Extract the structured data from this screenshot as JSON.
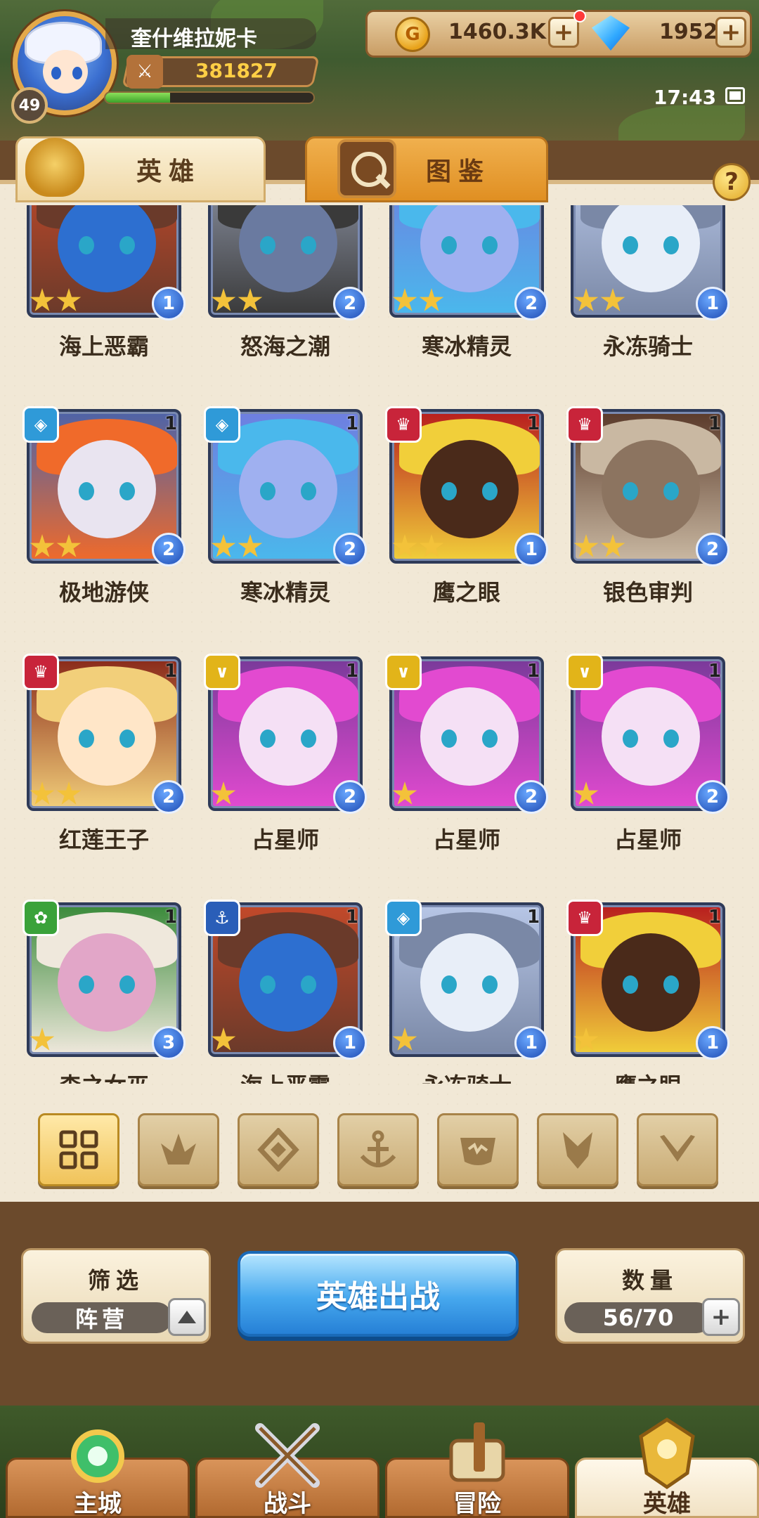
{
  "player": {
    "name": "奎什维拉妮卡",
    "level": "49",
    "power": "381827",
    "exp_fraction": 0.31
  },
  "currency": {
    "gold": "1460.3K",
    "gems": "1952"
  },
  "status": {
    "time": "17:43"
  },
  "tabs": {
    "heroes": "英雄",
    "codex": "图鉴"
  },
  "heroes": [
    {
      "name": "海上恶霸",
      "stars": 2,
      "rank": "1",
      "level": "",
      "faction": "",
      "colors": [
        "#c2492a",
        "#6a3a2a",
        "#2d6fd0"
      ]
    },
    {
      "name": "怒海之潮",
      "stars": 2,
      "rank": "2",
      "level": "",
      "faction": "",
      "colors": [
        "#8f96a8",
        "#3a3a3a",
        "#6a7aa0"
      ]
    },
    {
      "name": "寒冰精灵",
      "stars": 2,
      "rank": "2",
      "level": "",
      "faction": "",
      "colors": [
        "#6f7ee0",
        "#4ab8ec",
        "#9fb0f0"
      ]
    },
    {
      "name": "永冻骑士",
      "stars": 2,
      "rank": "1",
      "level": "",
      "faction": "",
      "colors": [
        "#b7c6e6",
        "#7a88a6",
        "#e8eef8"
      ]
    },
    {
      "name": "极地游侠",
      "stars": 2,
      "rank": "2",
      "level": "1",
      "faction": "ice",
      "colors": [
        "#4d63a8",
        "#f06a2a",
        "#e9e4f0"
      ]
    },
    {
      "name": "寒冰精灵",
      "stars": 2,
      "rank": "2",
      "level": "1",
      "faction": "ice",
      "colors": [
        "#6f7ee0",
        "#4ab8ec",
        "#9fb0f0"
      ]
    },
    {
      "name": "鹰之眼",
      "stars": 2,
      "rank": "1",
      "level": "1",
      "faction": "fire",
      "colors": [
        "#b81e1e",
        "#f1cf3a",
        "#4a2a1a"
      ]
    },
    {
      "name": "银色审判",
      "stars": 2,
      "rank": "2",
      "level": "1",
      "faction": "fire",
      "colors": [
        "#5a3a2a",
        "#c9b8a2",
        "#8c7460"
      ]
    },
    {
      "name": "红莲王子",
      "stars": 2,
      "rank": "2",
      "level": "1",
      "faction": "fire",
      "colors": [
        "#8a2a1a",
        "#f2cf7a",
        "#ffe6c8"
      ]
    },
    {
      "name": "占星师",
      "stars": 1,
      "rank": "2",
      "level": "1",
      "faction": "light",
      "colors": [
        "#7a3a9a",
        "#e24ad0",
        "#f5e0f5"
      ]
    },
    {
      "name": "占星师",
      "stars": 1,
      "rank": "2",
      "level": "1",
      "faction": "light",
      "colors": [
        "#7a3a9a",
        "#e24ad0",
        "#f5e0f5"
      ]
    },
    {
      "name": "占星师",
      "stars": 1,
      "rank": "2",
      "level": "1",
      "faction": "light",
      "colors": [
        "#7a3a9a",
        "#e24ad0",
        "#f5e0f5"
      ]
    },
    {
      "name": "森之女巫",
      "stars": 1,
      "rank": "3",
      "level": "1",
      "faction": "forest",
      "colors": [
        "#3a8a3a",
        "#efe8dc",
        "#e2a6c8"
      ]
    },
    {
      "name": "海上恶霸",
      "stars": 1,
      "rank": "1",
      "level": "1",
      "faction": "sea",
      "colors": [
        "#c2492a",
        "#6a3a2a",
        "#2d6fd0"
      ]
    },
    {
      "name": "永冻骑士",
      "stars": 1,
      "rank": "1",
      "level": "1",
      "faction": "ice",
      "colors": [
        "#b7c6e6",
        "#7a88a6",
        "#e8eef8"
      ]
    },
    {
      "name": "鹰之眼",
      "stars": 1,
      "rank": "1",
      "level": "1",
      "faction": "fire",
      "colors": [
        "#b81e1e",
        "#f1cf3a",
        "#4a2a1a"
      ]
    }
  ],
  "faction_colors": {
    "ice": "#2f9ad8",
    "fire": "#c8243a",
    "light": "#e2b419",
    "forest": "#3aa23a",
    "sea": "#2a5eb8"
  },
  "faction_filters": [
    "all-icon",
    "fire-faction-icon",
    "ice-faction-icon",
    "sea-faction-icon",
    "beast-faction-icon",
    "dark-faction-icon",
    "light-faction-icon"
  ],
  "controls": {
    "filter_title": "筛选",
    "filter_value": "阵营",
    "deploy_label": "英雄出战",
    "count_title": "数量",
    "count_value": "56/70"
  },
  "bottom_nav": [
    {
      "label": "主城",
      "icon": "castle-icon",
      "active": false
    },
    {
      "label": "战斗",
      "icon": "crossed-swords-icon",
      "active": false
    },
    {
      "label": "冒险",
      "icon": "scroll-map-icon",
      "active": false
    },
    {
      "label": "英雄",
      "icon": "golden-helmet-icon",
      "active": true
    }
  ]
}
